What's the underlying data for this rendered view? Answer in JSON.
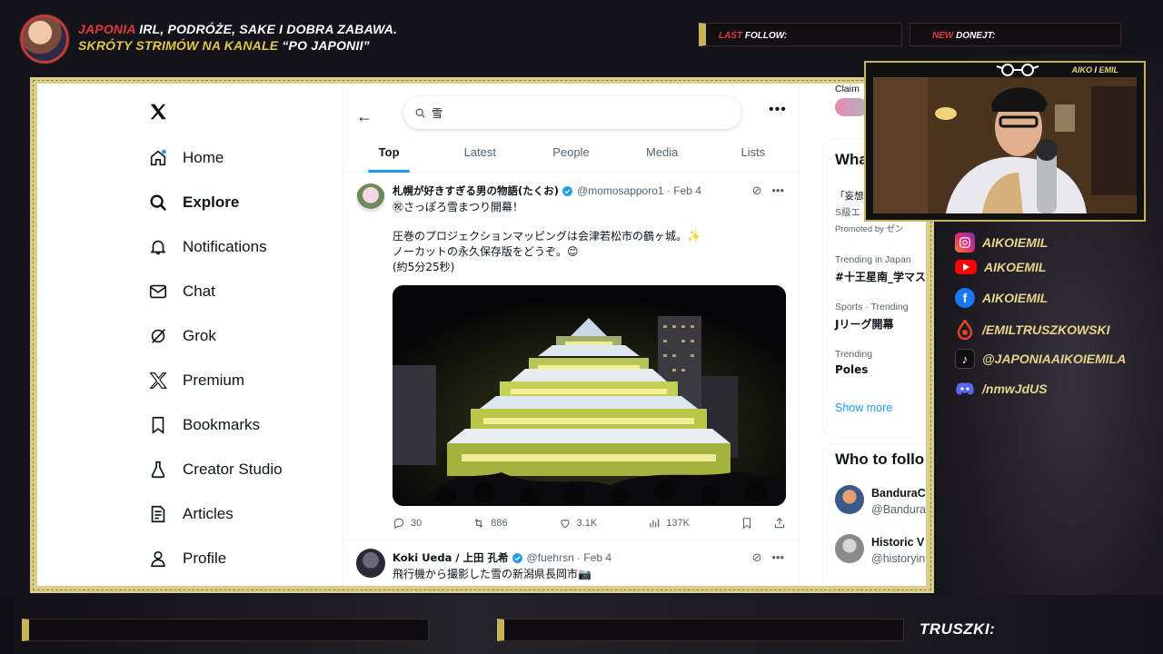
{
  "overlay": {
    "header_line1_red": "JAPONIA",
    "header_line1_rest": " IRL, PODRÓŻE, SAKE I DOBRA ZABAWA.",
    "header_line2_gold": "SKRÓTY STRIMÓW NA KANALE ",
    "header_line2_white": "“PO JAPONII”",
    "last_follow_prefix": "LAST",
    "last_follow_label": " FOLLOW:",
    "new_donate_prefix": "NEW",
    "new_donate_label": " DONEJT:",
    "cam_label_gold": "AIKO ",
    "cam_label_white": "I",
    "cam_label_gold2": " EMIL",
    "socials": [
      {
        "icon": "instagram-icon",
        "color": "#d62976",
        "text": "AIKOIEMIL"
      },
      {
        "icon": "youtube-icon",
        "color": "#ff0000",
        "text": "AIKOEMIL"
      },
      {
        "icon": "facebook-icon",
        "color": "#1877f2",
        "text": "AIKOIEMIL"
      },
      {
        "icon": "patronite-icon",
        "color": "#e8432a",
        "text": "/EMILTRUSZKOWSKI"
      },
      {
        "icon": "tiktok-icon",
        "color": "#111111",
        "text": "@JAPONIAAIKOIEMILA"
      },
      {
        "icon": "discord-icon",
        "color": "#5865f2",
        "text": "/nmwJdUS"
      }
    ],
    "bottom_label": "TRUSZKI:"
  },
  "nav": {
    "items": [
      {
        "label": "Home",
        "icon": "home-icon"
      },
      {
        "label": "Explore",
        "icon": "search-icon"
      },
      {
        "label": "Notifications",
        "icon": "bell-icon"
      },
      {
        "label": "Chat",
        "icon": "mail-icon"
      },
      {
        "label": "Grok",
        "icon": "grok-icon"
      },
      {
        "label": "Premium",
        "icon": "x-icon"
      },
      {
        "label": "Bookmarks",
        "icon": "bookmark-icon"
      },
      {
        "label": "Creator Studio",
        "icon": "flask-icon"
      },
      {
        "label": "Articles",
        "icon": "article-icon"
      },
      {
        "label": "Profile",
        "icon": "person-icon"
      }
    ]
  },
  "search": {
    "value": "雪"
  },
  "tabs": [
    "Top",
    "Latest",
    "People",
    "Media",
    "Lists"
  ],
  "tweets": [
    {
      "name": "札幌が好きすぎる男の物語(たくお)",
      "handle": "@momosapporo1 · Feb 4",
      "line1": "㊗さっぽろ雪まつり開幕！",
      "body": "圧巻のプロジェクションマッピングは会津若松市の鶴ヶ城。✨\nノーカットの永久保存版をどうぞ。😊\n(約5分25秒)",
      "replies": "30",
      "reposts": "886",
      "likes": "3.1K",
      "views": "137K"
    },
    {
      "name": "Koki Ueda / 上田 孔希",
      "handle": "@fuehrsn · Feb 4",
      "body": "飛行機から撮影した雪の新潟県長岡市📷"
    }
  ],
  "right": {
    "top_partial": "Claim",
    "whats_title": "What",
    "promo_line1": "「妄想",
    "promo_line2": "S級エ",
    "promo_line3": "Promoted by ゼン",
    "trends": [
      {
        "meta": "Trending in Japan",
        "name": "#十王星南_学マス"
      },
      {
        "meta": "Sports · Trending",
        "name": "Jリーグ開幕"
      },
      {
        "meta": "Trending",
        "name": "Poles"
      }
    ],
    "show_more": "Show more",
    "who_title": "Who to follo",
    "follow": [
      {
        "name": "BanduraC",
        "handle": "@Bandura"
      },
      {
        "name": "Historic V",
        "handle": "@historyin"
      }
    ]
  },
  "colors": {
    "accent": "#1d9bf0",
    "frame": "#d9cf8a",
    "overlay_gold": "#e6d48a",
    "overlay_red": "#e23b3b"
  }
}
